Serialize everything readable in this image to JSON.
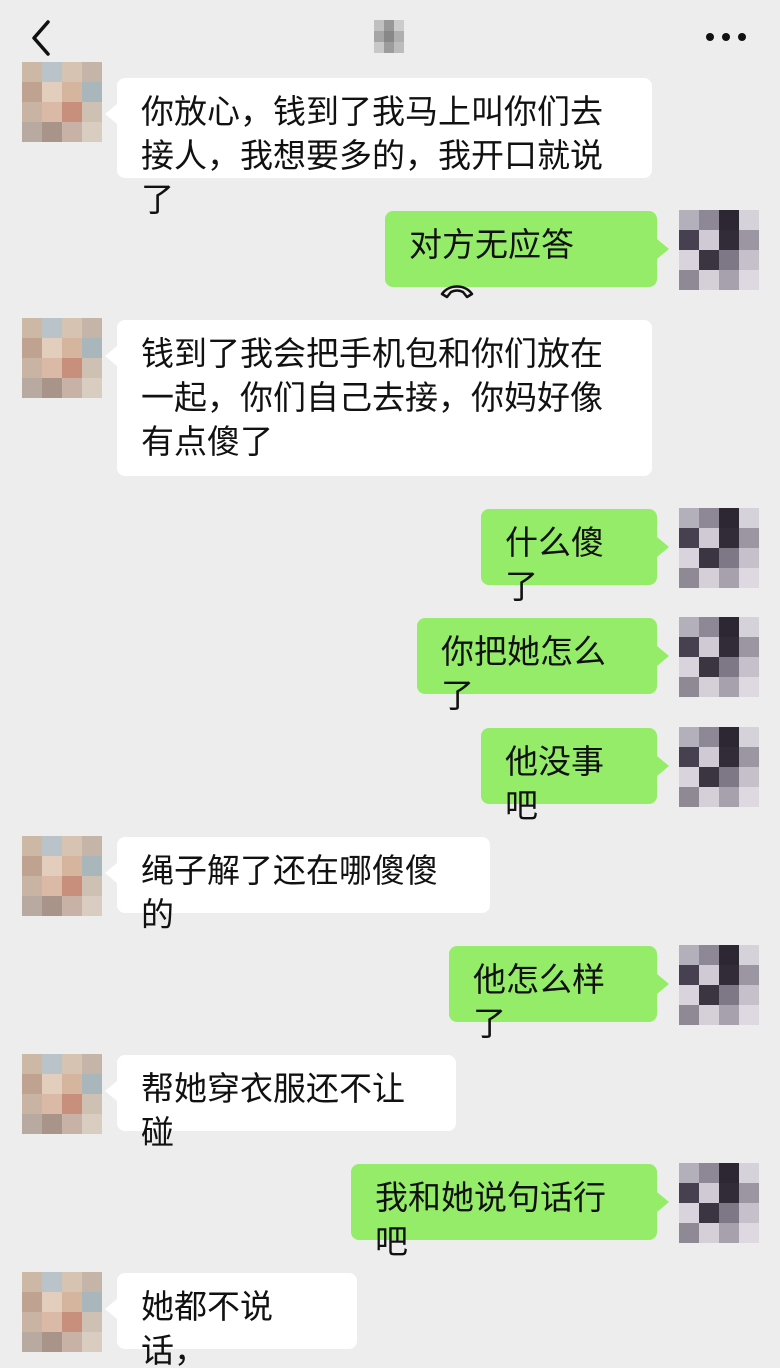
{
  "header": {
    "back_icon": "chevron-left-icon",
    "title": "",
    "more_icon": "more-dots-icon"
  },
  "colors": {
    "background": "#ededed",
    "incoming_bubble": "#ffffff",
    "outgoing_bubble": "#95ec69"
  },
  "messages": [
    {
      "side": "in",
      "text": "你放心，钱到了我马上叫你们去接人，我想要多的，我开口就说了"
    },
    {
      "side": "out",
      "text": "对方无应答",
      "icon": "hangup-phone-icon"
    },
    {
      "side": "in",
      "text": "钱到了我会把手机包和你们放在一起，你们自己去接，你妈好像有点傻了"
    },
    {
      "side": "out",
      "text": "什么傻了"
    },
    {
      "side": "out",
      "text": "你把她怎么了"
    },
    {
      "side": "out",
      "text": "他没事吧"
    },
    {
      "side": "in",
      "text": "绳子解了还在哪傻傻的"
    },
    {
      "side": "out",
      "text": "他怎么样了"
    },
    {
      "side": "in",
      "text": "帮她穿衣服还不让碰"
    },
    {
      "side": "out",
      "text": "我和她说句话行吧"
    },
    {
      "side": "in",
      "text": "她都不说话，"
    }
  ]
}
